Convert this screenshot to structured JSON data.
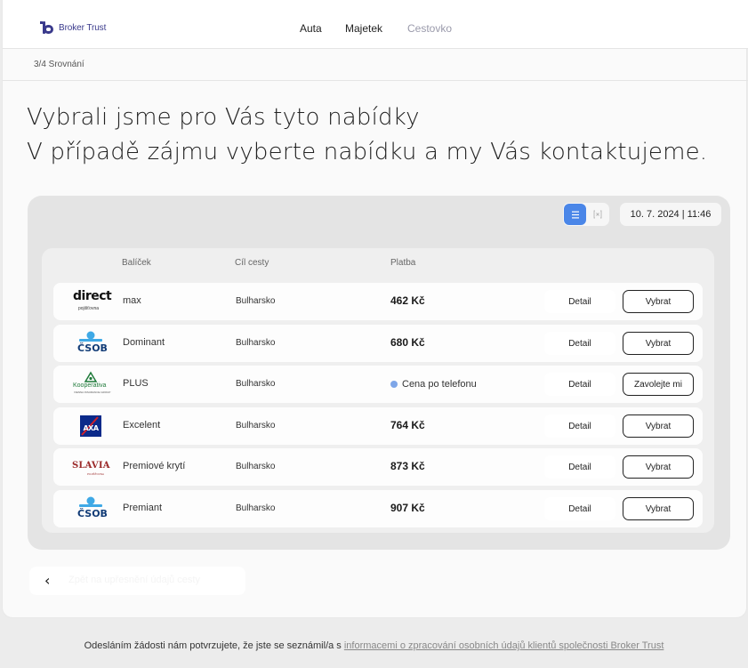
{
  "brand": {
    "name": "Broker Trust"
  },
  "nav": {
    "items": [
      {
        "label": "Auta"
      },
      {
        "label": "Majetek"
      },
      {
        "label": "Cestovko"
      }
    ]
  },
  "breadcrumb": "3/4 Srovnání",
  "heading": {
    "line1": "Vybrali jsme pro Vás tyto nabídky",
    "line2": "V případě zájmu vyberte nabídku a my Vás kontaktujeme."
  },
  "view_toggle": {
    "list_icon": "list-icon",
    "grid_icon": "grid-icon",
    "active": "list",
    "active_color": "#4a86e8"
  },
  "datetime": "10. 7. 2024 | 11:46",
  "table": {
    "columns": {
      "package": "Balíček",
      "destination": "Cíl cesty",
      "payment": "Platba"
    },
    "rows": [
      {
        "logo": {
          "name": "direct",
          "sub": "pojišťovna"
        },
        "package": "max",
        "destination": "Bulharsko",
        "price": "462 Kč",
        "detail": "Detail",
        "action": "Vybrat"
      },
      {
        "logo": {
          "name": "ČSOB"
        },
        "package": "Dominant",
        "destination": "Bulharsko",
        "price": "680 Kč",
        "detail": "Detail",
        "action": "Vybrat"
      },
      {
        "logo": {
          "name": "Kooperativa",
          "sub": "VIENNA INSURANCE GROUP"
        },
        "package": "PLUS",
        "destination": "Bulharsko",
        "price": "Cena po telefonu",
        "phone": true,
        "detail": "Detail",
        "action": "Zavolejte mi"
      },
      {
        "logo": {
          "name": "AXA"
        },
        "package": "Excelent",
        "destination": "Bulharsko",
        "price": "764 Kč",
        "detail": "Detail",
        "action": "Vybrat"
      },
      {
        "logo": {
          "name": "SLAVIA",
          "sub": "POJIŠŤOVNA"
        },
        "package": "Premiové krytí",
        "destination": "Bulharsko",
        "price": "873 Kč",
        "detail": "Detail",
        "action": "Vybrat"
      },
      {
        "logo": {
          "name": "ČSOB"
        },
        "package": "Premiant",
        "destination": "Bulharsko",
        "price": "907 Kč",
        "detail": "Detail",
        "action": "Vybrat"
      }
    ]
  },
  "back_button": {
    "icon": "chevron-left-icon",
    "label": "Zpět na upřesnění údajů cesty"
  },
  "footer": {
    "text": "Odesláním žádosti nám potvrzujete, že jste se seznámil/a s ",
    "link": "informacemi o zpracování osobních údajů klientů společnosti Broker Trust"
  }
}
